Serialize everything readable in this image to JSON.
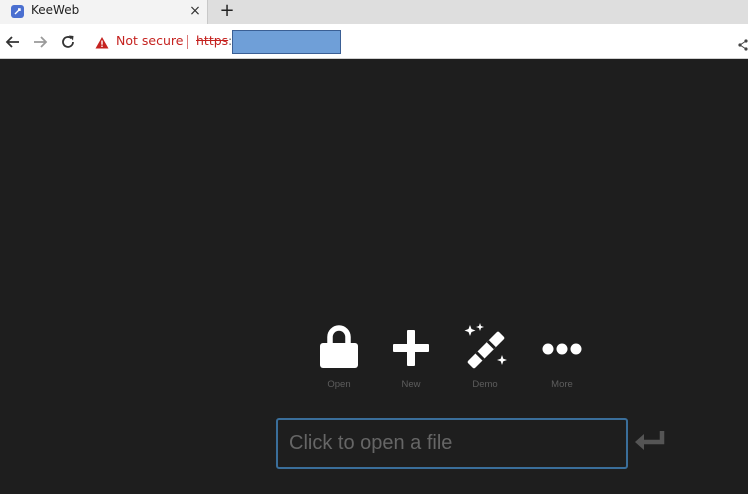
{
  "browser": {
    "tab": {
      "title": "KeeWeb",
      "close_glyph": "×",
      "favicon": "keeweb-favicon-icon"
    },
    "new_tab_glyph": "+",
    "nav": {
      "back_icon": "back-arrow-icon",
      "forward_icon": "forward-arrow-icon",
      "reload_icon": "reload-icon"
    },
    "address_bar": {
      "security_icon": "warning-triangle-icon",
      "security_text": "Not secure",
      "url_scheme": "https",
      "url_rest": ":",
      "url_redacted": true
    },
    "share_icon": "share-icon"
  },
  "app": {
    "actions": [
      {
        "label": "Open",
        "icon": "lock-icon"
      },
      {
        "label": "New",
        "icon": "plus-icon"
      },
      {
        "label": "Demo",
        "icon": "magic-wand-icon"
      },
      {
        "label": "More",
        "icon": "ellipsis-icon"
      }
    ],
    "file_input": {
      "placeholder": "Click to open a file",
      "value": ""
    },
    "enter_icon": "enter-return-icon"
  },
  "colors": {
    "background": "#1e1e1e",
    "icon": "#ffffff",
    "label": "#5d5d5d",
    "input_border": "#3a6e9a",
    "not_secure": "#c5221f",
    "redaction": "#6f9fd8"
  }
}
